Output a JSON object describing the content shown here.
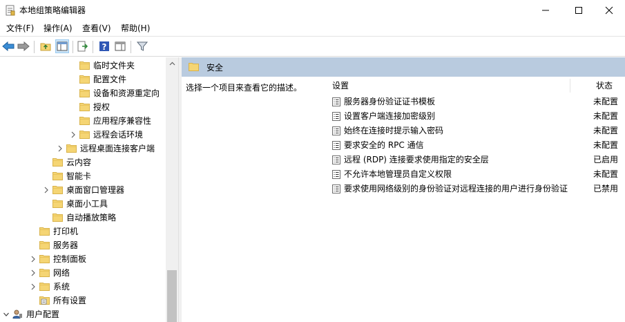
{
  "window": {
    "title": "本地组策略编辑器"
  },
  "menu": [
    "文件(F)",
    "操作(A)",
    "查看(V)",
    "帮助(H)"
  ],
  "tree": {
    "items": [
      {
        "label": "临时文件夹",
        "expander": false,
        "icon": "folder-icon"
      },
      {
        "label": "配置文件",
        "expander": false,
        "icon": "folder-icon"
      },
      {
        "label": "设备和资源重定向",
        "expander": false,
        "icon": "folder-icon"
      },
      {
        "label": "授权",
        "expander": false,
        "icon": "folder-icon"
      },
      {
        "label": "应用程序兼容性",
        "expander": false,
        "icon": "folder-icon"
      },
      {
        "label": "远程会话环境",
        "expander": true,
        "icon": "folder-icon"
      },
      {
        "label": "远程桌面连接客户端",
        "expander": true,
        "icon": "folder-icon"
      },
      {
        "label": "云内容",
        "expander": false,
        "icon": "folder-icon"
      },
      {
        "label": "智能卡",
        "expander": false,
        "icon": "folder-icon"
      },
      {
        "label": "桌面窗口管理器",
        "expander": true,
        "icon": "folder-icon"
      },
      {
        "label": "桌面小工具",
        "expander": false,
        "icon": "folder-icon"
      },
      {
        "label": "自动播放策略",
        "expander": false,
        "icon": "folder-icon"
      },
      {
        "label": "打印机",
        "expander": false,
        "icon": "folder-icon"
      },
      {
        "label": "服务器",
        "expander": false,
        "icon": "folder-icon"
      },
      {
        "label": "控制面板",
        "expander": true,
        "icon": "folder-icon"
      },
      {
        "label": "网络",
        "expander": true,
        "icon": "folder-icon"
      },
      {
        "label": "系统",
        "expander": true,
        "icon": "folder-icon"
      },
      {
        "label": "所有设置",
        "expander": false,
        "icon": "settings-folder-icon"
      },
      {
        "label": "用户配置",
        "expander": "expanded",
        "icon": "user-config-icon"
      }
    ]
  },
  "section": {
    "title": "安全",
    "description": "选择一个项目来查看它的描述。"
  },
  "list": {
    "columns": {
      "setting": "设置",
      "status": "状态"
    },
    "rows": [
      {
        "setting": "服务器身份验证证书模板",
        "status": "未配置"
      },
      {
        "setting": "设置客户端连接加密级别",
        "status": "未配置"
      },
      {
        "setting": "始终在连接时提示输入密码",
        "status": "未配置"
      },
      {
        "setting": "要求安全的 RPC 通信",
        "status": "未配置"
      },
      {
        "setting": "远程 (RDP) 连接要求使用指定的安全层",
        "status": "已启用"
      },
      {
        "setting": "不允许本地管理员自定义权限",
        "status": "未配置"
      },
      {
        "setting": "要求使用网络级别的身份验证对远程连接的用户进行身份验证",
        "status": "已禁用"
      }
    ]
  },
  "colors": {
    "section_header": "#b9cbdf",
    "folder": "#f5d574",
    "folder_edge": "#d8b24a"
  }
}
